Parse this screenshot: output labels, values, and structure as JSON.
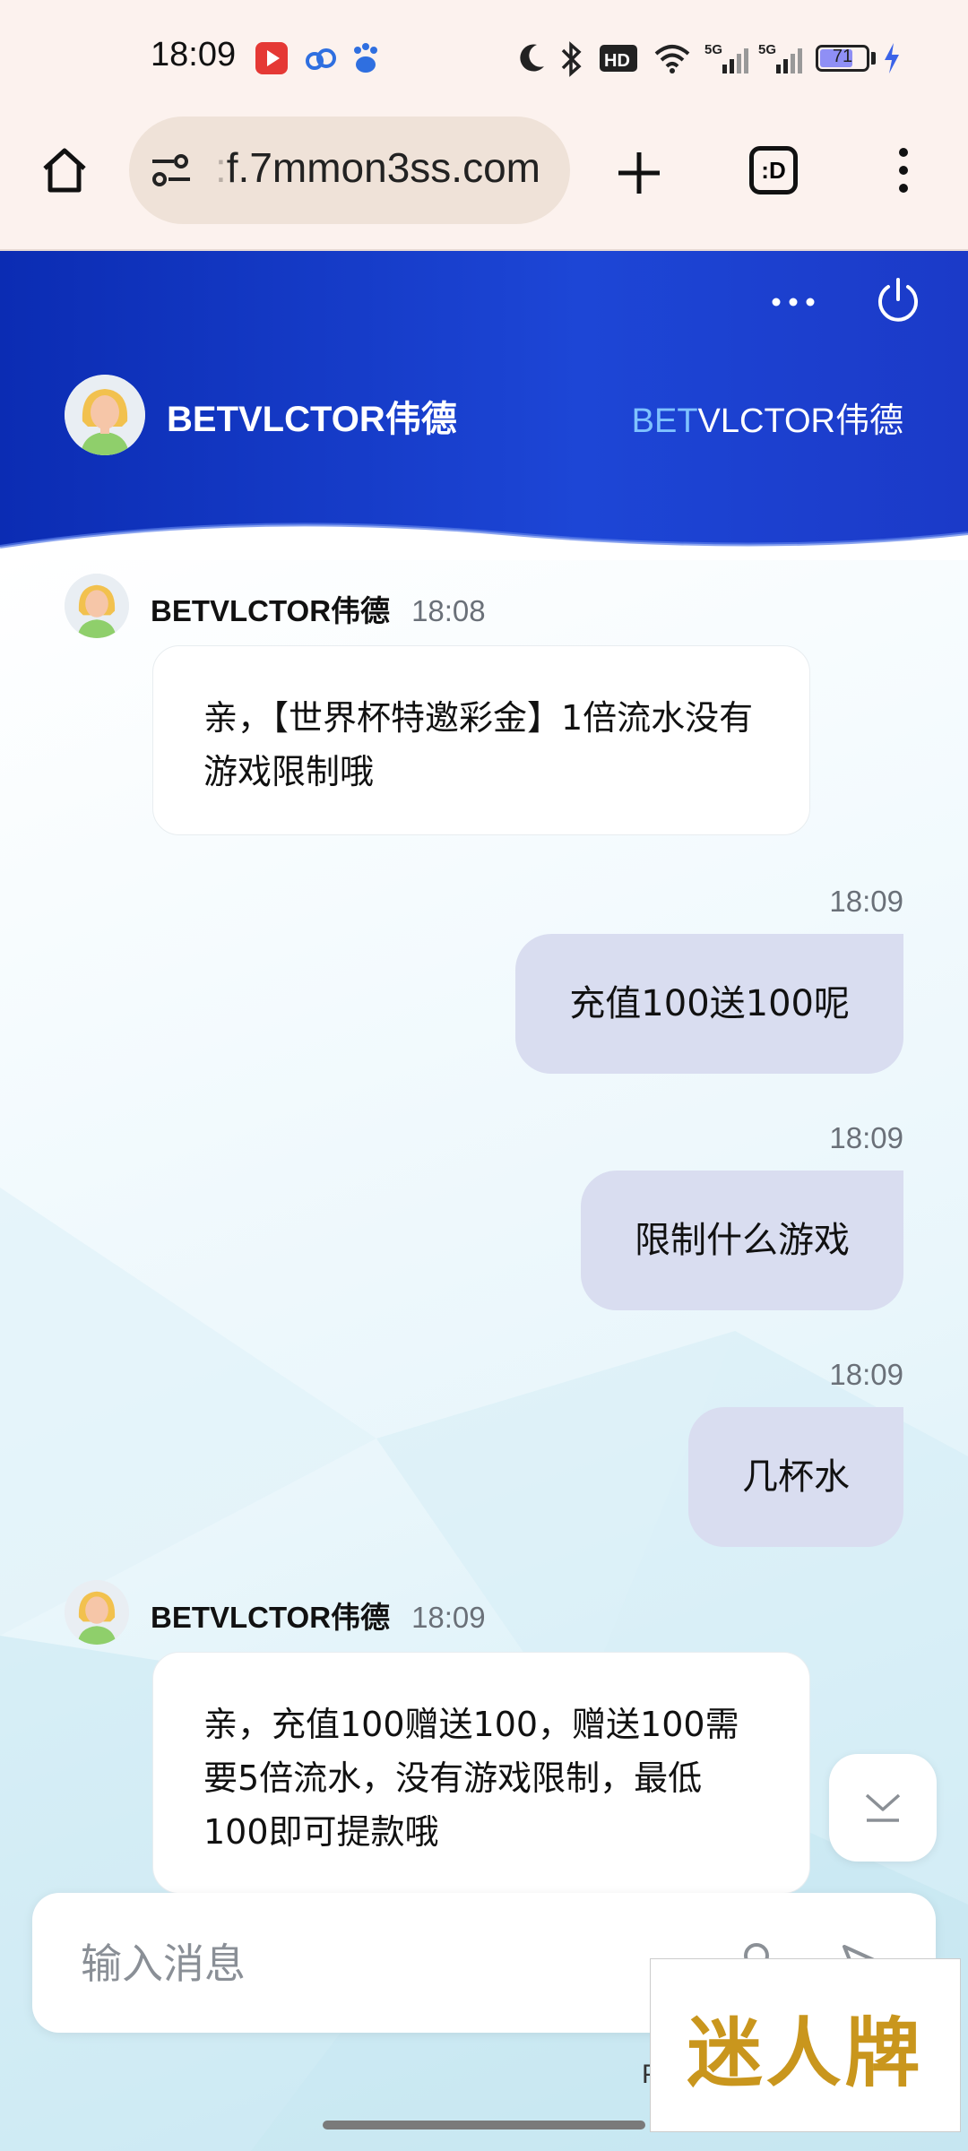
{
  "status_bar": {
    "time": "18:09",
    "battery": "71",
    "battery_level": 0.71,
    "icons": [
      "youtube-icon",
      "cloud-icon",
      "baidu-icon",
      "moon-icon",
      "bluetooth-icon",
      "hd-icon",
      "wifi-icon",
      "signal-5g-icon",
      "signal-5g-icon",
      "battery-icon",
      "charging-icon"
    ]
  },
  "browser": {
    "url_prefix": ":",
    "url": "f.7mmon3ss.com",
    "tab_count": ":D"
  },
  "header": {
    "name": "BETVLCTOR伟德",
    "logo_bet": "BET",
    "logo_rest": "VLCTOR伟德"
  },
  "messages": [
    {
      "direction": "in",
      "sender": "BETVLCTOR伟德",
      "time": "18:08",
      "text": "亲，【世界杯特邀彩金】1倍流水没有游戏限制哦"
    },
    {
      "direction": "out",
      "time": "18:09",
      "text": "充值100送100呢"
    },
    {
      "direction": "out",
      "time": "18:09",
      "text": "限制什么游戏"
    },
    {
      "direction": "out",
      "time": "18:09",
      "text": "几杯水"
    },
    {
      "direction": "in",
      "sender": "BETVLCTOR伟德",
      "time": "18:09",
      "text": "亲，充值100赠送100，赠送100需要5倍流水，没有游戏限制，最低100即可提款哦"
    }
  ],
  "input": {
    "placeholder": "输入消息"
  },
  "footer": {
    "powered_fragment": "P"
  },
  "watermark": {
    "text": "迷人牌"
  },
  "colors": {
    "header_blue": "#1d46d6",
    "bubble_out": "#d9ddf0",
    "brand_accent": "#7fc2ff"
  }
}
